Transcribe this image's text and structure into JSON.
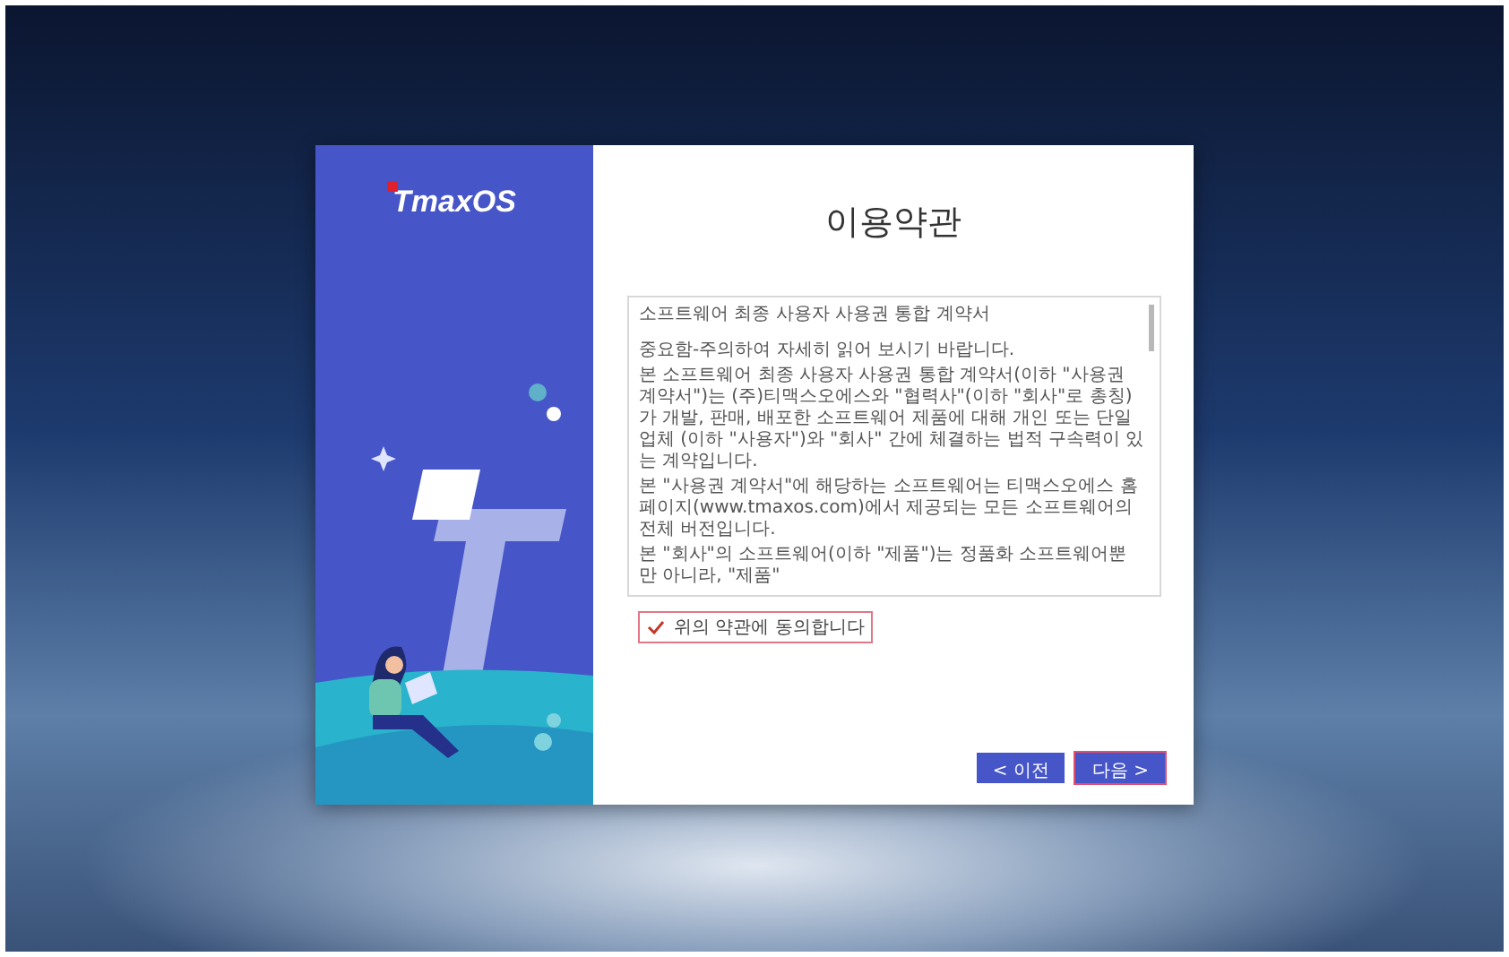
{
  "logo": {
    "text": "TmaxOS"
  },
  "title": "이용약관",
  "agreement": {
    "paragraphs": [
      "소프트웨어 최종 사용자 사용권 통합 계약서",
      "중요함-주의하여 자세히 읽어 보시기 바랍니다.",
      "본 소프트웨어 최종 사용자 사용권 통합 계약서(이하 \"사용권 계약서\")는 (주)티맥스오에스와 \"협력사\"(이하 \"회사\"로 총칭)가 개발, 판매, 배포한 소프트웨어 제품에 대해 개인 또는 단일 업체 (이하 \"사용자\")와 \"회사\" 간에 체결하는 법적 구속력이 있는 계약입니다.",
      "본 \"사용권 계약서\"에 해당하는 소프트웨어는 티맥스오에스 홈페이지(www.tmaxos.com)에서 제공되는 모든 소프트웨어의 전체 버전입니다.",
      "본 \"회사\"의 소프트웨어(이하 \"제품\")는 정품화 소프트웨어뿐만 아니라, \"제품\""
    ]
  },
  "consent": {
    "label": "위의 약관에 동의합니다",
    "checked": true
  },
  "buttons": [
    {
      "label": "< 이전",
      "focused": false
    },
    {
      "label": "다음 >",
      "focused": true
    }
  ]
}
